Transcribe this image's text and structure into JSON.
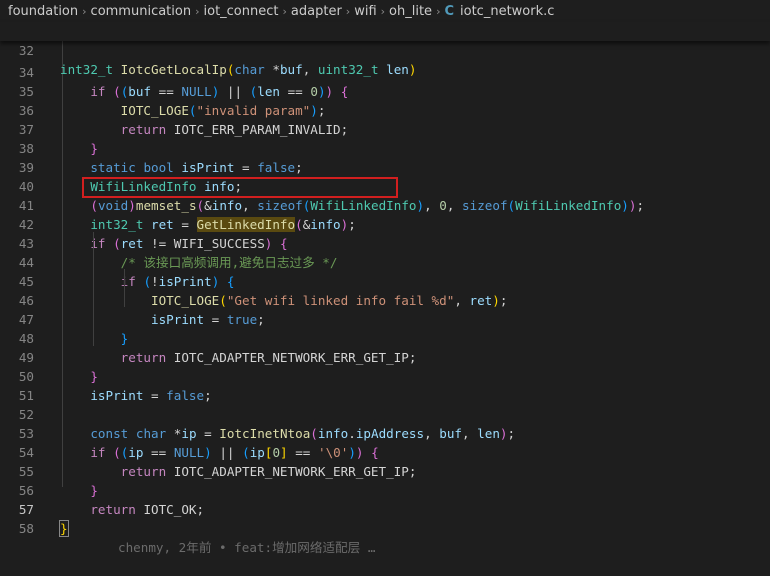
{
  "breadcrumb": {
    "items": [
      "foundation",
      "communication",
      "iot_connect",
      "adapter",
      "wifi",
      "oh_lite"
    ],
    "file_icon": "C",
    "file_name": "iotc_network.c"
  },
  "sticky": {
    "line_number": "32",
    "code": "int32_t IotcGetLocalIp(char *buf, uint32_t len)"
  },
  "lines": [
    {
      "n": "34"
    },
    {
      "n": "35"
    },
    {
      "n": "36"
    },
    {
      "n": "37"
    },
    {
      "n": "38"
    },
    {
      "n": "39"
    },
    {
      "n": "40"
    },
    {
      "n": "41"
    },
    {
      "n": "42"
    },
    {
      "n": "43"
    },
    {
      "n": "44"
    },
    {
      "n": "45"
    },
    {
      "n": "46"
    },
    {
      "n": "47"
    },
    {
      "n": "48"
    },
    {
      "n": "49"
    },
    {
      "n": "50"
    },
    {
      "n": "51"
    },
    {
      "n": "52"
    },
    {
      "n": "53"
    },
    {
      "n": "54"
    },
    {
      "n": "55"
    },
    {
      "n": "56"
    },
    {
      "n": "57"
    },
    {
      "n": "58"
    }
  ],
  "code": {
    "l43_comment": "/* 该接口高频调用,避免日志过多 */",
    "l45_string": "\"Get wifi linked info fail %d\"",
    "l35_string": "\"invalid param\"",
    "l53_char": "'\\0'"
  },
  "blame": "chenmy, 2年前 • feat:增加网络适配层 …",
  "highlight": {
    "color": "#d21f1f"
  }
}
